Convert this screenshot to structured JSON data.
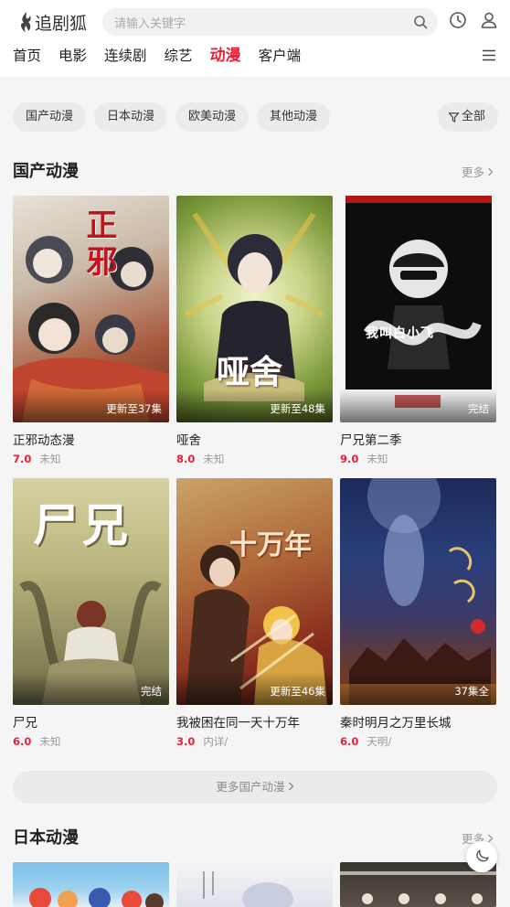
{
  "header": {
    "logo_text": "追剧狐",
    "search_placeholder": "请输入关键字",
    "icons": [
      "flame-logo-icon",
      "search-icon",
      "history-clock-icon",
      "user-icon",
      "menu-icon"
    ]
  },
  "nav": {
    "items": [
      {
        "label": "首页",
        "active": false
      },
      {
        "label": "电影",
        "active": false
      },
      {
        "label": "连续剧",
        "active": false
      },
      {
        "label": "综艺",
        "active": false
      },
      {
        "label": "动漫",
        "active": true
      },
      {
        "label": "客户端",
        "active": false
      }
    ]
  },
  "filters": {
    "chips": [
      "国产动漫",
      "日本动漫",
      "欧美动漫",
      "其他动漫"
    ],
    "all_label": "全部"
  },
  "sections": [
    {
      "title": "国产动漫",
      "more_label": "更多",
      "items": [
        {
          "title": "正邪动态漫",
          "score": "7.0",
          "sub": "未知",
          "status": "更新至37集",
          "poster_text": "正邪"
        },
        {
          "title": "哑舍",
          "score": "8.0",
          "sub": "未知",
          "status": "更新至48集",
          "poster_text": "哑舍"
        },
        {
          "title": "尸兄第二季",
          "score": "9.0",
          "sub": "未知",
          "status": "完结",
          "poster_text": "我叫白小飞"
        },
        {
          "title": "尸兄",
          "score": "6.0",
          "sub": "未知",
          "status": "完结",
          "poster_text": "尸兄"
        },
        {
          "title": "我被困在同一天十万年",
          "score": "3.0",
          "sub": "内详/",
          "status": "更新至46集",
          "poster_text": "十万年"
        },
        {
          "title": "秦时明月之万里长城",
          "score": "6.0",
          "sub": "天明/",
          "status": "37集全",
          "poster_text": ""
        }
      ],
      "more_button": "更多国产动漫"
    },
    {
      "title": "日本动漫",
      "more_label": "更多"
    }
  ],
  "colors": {
    "accent": "#e8203a",
    "background": "#f5f5f5",
    "chip": "#ebebed"
  }
}
